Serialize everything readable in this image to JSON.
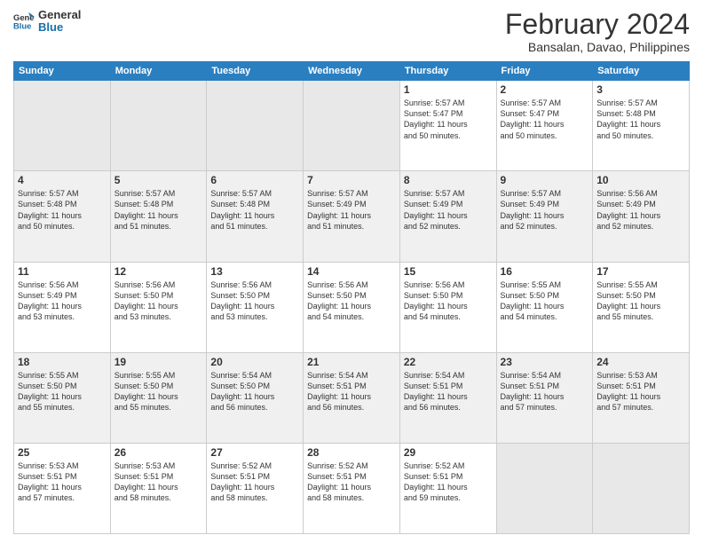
{
  "logo": {
    "line1": "General",
    "line2": "Blue"
  },
  "title": "February 2024",
  "subtitle": "Bansalan, Davao, Philippines",
  "days_of_week": [
    "Sunday",
    "Monday",
    "Tuesday",
    "Wednesday",
    "Thursday",
    "Friday",
    "Saturday"
  ],
  "weeks": [
    [
      {
        "day": "",
        "info": ""
      },
      {
        "day": "",
        "info": ""
      },
      {
        "day": "",
        "info": ""
      },
      {
        "day": "",
        "info": ""
      },
      {
        "day": "1",
        "info": "Sunrise: 5:57 AM\nSunset: 5:47 PM\nDaylight: 11 hours\nand 50 minutes."
      },
      {
        "day": "2",
        "info": "Sunrise: 5:57 AM\nSunset: 5:47 PM\nDaylight: 11 hours\nand 50 minutes."
      },
      {
        "day": "3",
        "info": "Sunrise: 5:57 AM\nSunset: 5:48 PM\nDaylight: 11 hours\nand 50 minutes."
      }
    ],
    [
      {
        "day": "4",
        "info": "Sunrise: 5:57 AM\nSunset: 5:48 PM\nDaylight: 11 hours\nand 50 minutes."
      },
      {
        "day": "5",
        "info": "Sunrise: 5:57 AM\nSunset: 5:48 PM\nDaylight: 11 hours\nand 51 minutes."
      },
      {
        "day": "6",
        "info": "Sunrise: 5:57 AM\nSunset: 5:48 PM\nDaylight: 11 hours\nand 51 minutes."
      },
      {
        "day": "7",
        "info": "Sunrise: 5:57 AM\nSunset: 5:49 PM\nDaylight: 11 hours\nand 51 minutes."
      },
      {
        "day": "8",
        "info": "Sunrise: 5:57 AM\nSunset: 5:49 PM\nDaylight: 11 hours\nand 52 minutes."
      },
      {
        "day": "9",
        "info": "Sunrise: 5:57 AM\nSunset: 5:49 PM\nDaylight: 11 hours\nand 52 minutes."
      },
      {
        "day": "10",
        "info": "Sunrise: 5:56 AM\nSunset: 5:49 PM\nDaylight: 11 hours\nand 52 minutes."
      }
    ],
    [
      {
        "day": "11",
        "info": "Sunrise: 5:56 AM\nSunset: 5:49 PM\nDaylight: 11 hours\nand 53 minutes."
      },
      {
        "day": "12",
        "info": "Sunrise: 5:56 AM\nSunset: 5:50 PM\nDaylight: 11 hours\nand 53 minutes."
      },
      {
        "day": "13",
        "info": "Sunrise: 5:56 AM\nSunset: 5:50 PM\nDaylight: 11 hours\nand 53 minutes."
      },
      {
        "day": "14",
        "info": "Sunrise: 5:56 AM\nSunset: 5:50 PM\nDaylight: 11 hours\nand 54 minutes."
      },
      {
        "day": "15",
        "info": "Sunrise: 5:56 AM\nSunset: 5:50 PM\nDaylight: 11 hours\nand 54 minutes."
      },
      {
        "day": "16",
        "info": "Sunrise: 5:55 AM\nSunset: 5:50 PM\nDaylight: 11 hours\nand 54 minutes."
      },
      {
        "day": "17",
        "info": "Sunrise: 5:55 AM\nSunset: 5:50 PM\nDaylight: 11 hours\nand 55 minutes."
      }
    ],
    [
      {
        "day": "18",
        "info": "Sunrise: 5:55 AM\nSunset: 5:50 PM\nDaylight: 11 hours\nand 55 minutes."
      },
      {
        "day": "19",
        "info": "Sunrise: 5:55 AM\nSunset: 5:50 PM\nDaylight: 11 hours\nand 55 minutes."
      },
      {
        "day": "20",
        "info": "Sunrise: 5:54 AM\nSunset: 5:50 PM\nDaylight: 11 hours\nand 56 minutes."
      },
      {
        "day": "21",
        "info": "Sunrise: 5:54 AM\nSunset: 5:51 PM\nDaylight: 11 hours\nand 56 minutes."
      },
      {
        "day": "22",
        "info": "Sunrise: 5:54 AM\nSunset: 5:51 PM\nDaylight: 11 hours\nand 56 minutes."
      },
      {
        "day": "23",
        "info": "Sunrise: 5:54 AM\nSunset: 5:51 PM\nDaylight: 11 hours\nand 57 minutes."
      },
      {
        "day": "24",
        "info": "Sunrise: 5:53 AM\nSunset: 5:51 PM\nDaylight: 11 hours\nand 57 minutes."
      }
    ],
    [
      {
        "day": "25",
        "info": "Sunrise: 5:53 AM\nSunset: 5:51 PM\nDaylight: 11 hours\nand 57 minutes."
      },
      {
        "day": "26",
        "info": "Sunrise: 5:53 AM\nSunset: 5:51 PM\nDaylight: 11 hours\nand 58 minutes."
      },
      {
        "day": "27",
        "info": "Sunrise: 5:52 AM\nSunset: 5:51 PM\nDaylight: 11 hours\nand 58 minutes."
      },
      {
        "day": "28",
        "info": "Sunrise: 5:52 AM\nSunset: 5:51 PM\nDaylight: 11 hours\nand 58 minutes."
      },
      {
        "day": "29",
        "info": "Sunrise: 5:52 AM\nSunset: 5:51 PM\nDaylight: 11 hours\nand 59 minutes."
      },
      {
        "day": "",
        "info": ""
      },
      {
        "day": "",
        "info": ""
      }
    ]
  ]
}
